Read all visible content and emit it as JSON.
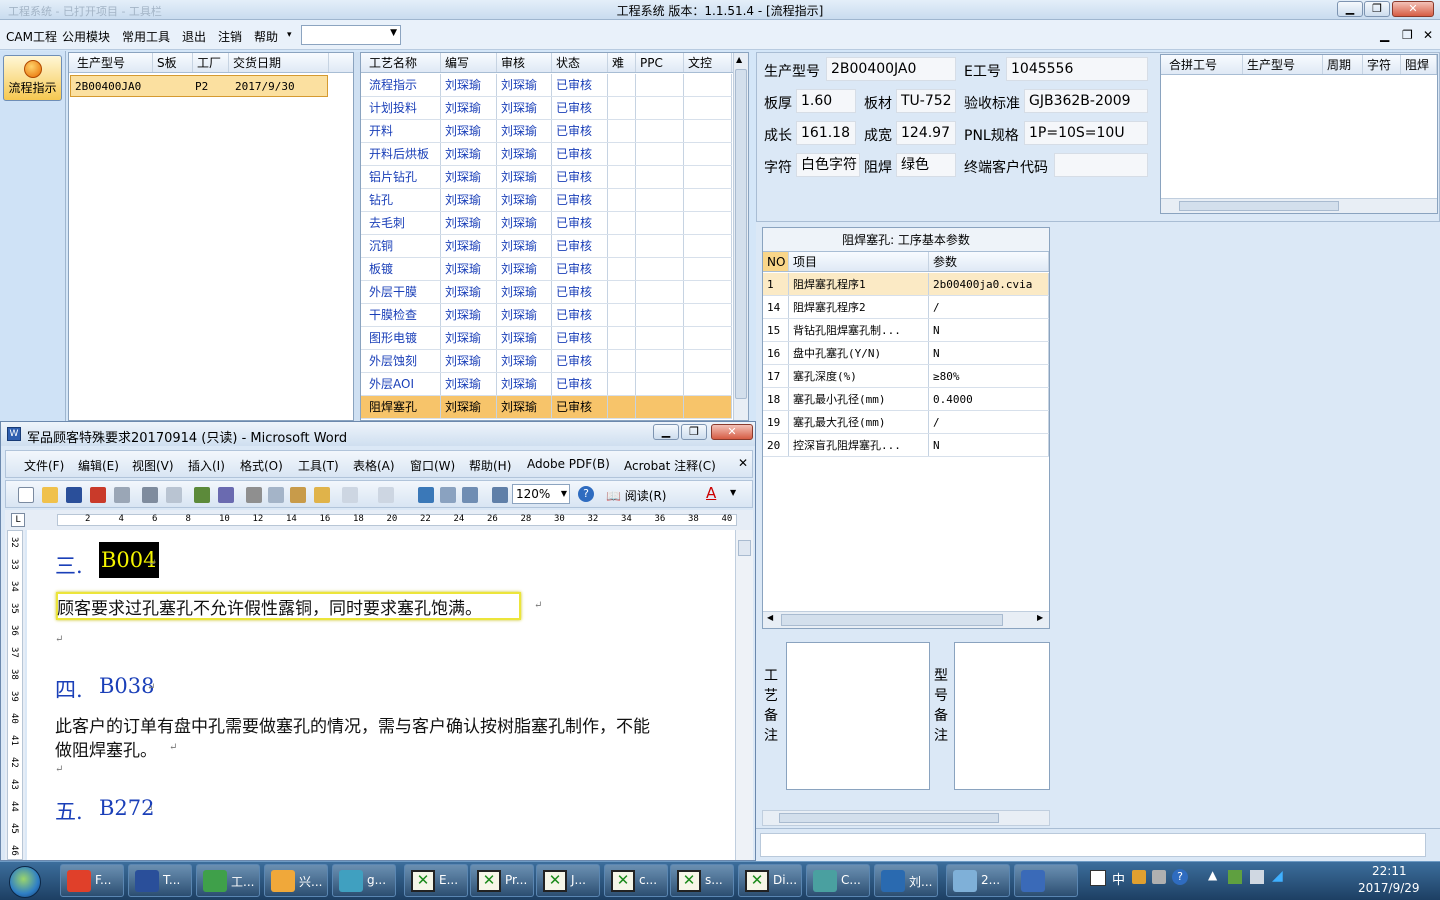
{
  "app": {
    "title": "工程系统   版本：1.1.51.4 - [流程指示]",
    "faint_title": "工程系统 - 已打开项目 - 工具栏",
    "window_buttons": {
      "minimize": "▁",
      "restore": "❐",
      "close": "✕"
    }
  },
  "menu": {
    "items": [
      "CAM工程",
      "公用模块",
      "常用工具",
      "退出",
      "注销",
      "帮助"
    ],
    "help_arrow": "▾",
    "mdi_buttons": [
      "▁",
      "❐",
      "✕"
    ]
  },
  "sidebar": {
    "flow_button": "流程指示"
  },
  "orders": {
    "headers": [
      "生产型号",
      "S板",
      "工厂",
      "交货日期"
    ],
    "rows": [
      {
        "model": "2B00400JA0",
        "s": "",
        "factory": "P2",
        "date": "2017/9/30"
      }
    ]
  },
  "process": {
    "headers": [
      "工艺名称",
      "编写",
      "审核",
      "状态",
      "难",
      "PPC",
      "文控"
    ],
    "rows": [
      {
        "name": "流程指示",
        "writer": "刘琛瑜",
        "reviewer": "刘琛瑜",
        "status": "已审核"
      },
      {
        "name": "计划投料",
        "writer": "刘琛瑜",
        "reviewer": "刘琛瑜",
        "status": "已审核"
      },
      {
        "name": "开料",
        "writer": "刘琛瑜",
        "reviewer": "刘琛瑜",
        "status": "已审核"
      },
      {
        "name": "开料后烘板",
        "writer": "刘琛瑜",
        "reviewer": "刘琛瑜",
        "status": "已审核"
      },
      {
        "name": "铝片钻孔",
        "writer": "刘琛瑜",
        "reviewer": "刘琛瑜",
        "status": "已审核"
      },
      {
        "name": "钻孔",
        "writer": "刘琛瑜",
        "reviewer": "刘琛瑜",
        "status": "已审核"
      },
      {
        "name": "去毛刺",
        "writer": "刘琛瑜",
        "reviewer": "刘琛瑜",
        "status": "已审核"
      },
      {
        "name": "沉铜",
        "writer": "刘琛瑜",
        "reviewer": "刘琛瑜",
        "status": "已审核"
      },
      {
        "name": "板镀",
        "writer": "刘琛瑜",
        "reviewer": "刘琛瑜",
        "status": "已审核"
      },
      {
        "name": "外层干膜",
        "writer": "刘琛瑜",
        "reviewer": "刘琛瑜",
        "status": "已审核"
      },
      {
        "name": "干膜检查",
        "writer": "刘琛瑜",
        "reviewer": "刘琛瑜",
        "status": "已审核"
      },
      {
        "name": "图形电镀",
        "writer": "刘琛瑜",
        "reviewer": "刘琛瑜",
        "status": "已审核"
      },
      {
        "name": "外层蚀刻",
        "writer": "刘琛瑜",
        "reviewer": "刘琛瑜",
        "status": "已审核"
      },
      {
        "name": "外层AOI",
        "writer": "刘琛瑜",
        "reviewer": "刘琛瑜",
        "status": "已审核"
      },
      {
        "name": "阻焊塞孔",
        "writer": "刘琛瑜",
        "reviewer": "刘琛瑜",
        "status": "已审核"
      }
    ]
  },
  "info": {
    "labels": {
      "model": "生产型号",
      "eno": "E工号",
      "thickness": "板厚",
      "material": "板材",
      "standard": "验收标准",
      "length": "成长",
      "width": "成宽",
      "pnl": "PNL规格",
      "char": "字符",
      "mask": "阻焊",
      "customer": "终端客户代码"
    },
    "values": {
      "model": "2B00400JA0",
      "eno": "1045556",
      "thickness": "1.60",
      "material": "TU-752",
      "standard": "GJB362B-2009",
      "length": "161.18",
      "width": "124.97",
      "pnl": "1P=10S=10U",
      "char": "白色字符",
      "mask": "绿色",
      "customer": ""
    }
  },
  "merge": {
    "headers": [
      "合拼工号",
      "生产型号",
      "周期",
      "字符",
      "阻焊"
    ]
  },
  "params": {
    "title": "阻焊塞孔: 工序基本参数",
    "headers": [
      "NO",
      "项目",
      "参数"
    ],
    "rows": [
      {
        "no": "1",
        "item": "阻焊塞孔程序1",
        "value": "2b00400ja0.cvia"
      },
      {
        "no": "14",
        "item": "阻焊塞孔程序2",
        "value": "/"
      },
      {
        "no": "15",
        "item": "背钻孔阻焊塞孔制...",
        "value": "N"
      },
      {
        "no": "16",
        "item": "盘中孔塞孔(Y/N)",
        "value": "N"
      },
      {
        "no": "17",
        "item": "塞孔深度(%)",
        "value": "≥80%"
      },
      {
        "no": "18",
        "item": "塞孔最小孔径(mm)",
        "value": "0.4000"
      },
      {
        "no": "19",
        "item": "塞孔最大孔径(mm)",
        "value": "/"
      },
      {
        "no": "20",
        "item": "控深盲孔阻焊塞孔...",
        "value": "N"
      }
    ]
  },
  "remarks": {
    "process": [
      "工",
      "艺",
      "备",
      "注"
    ],
    "model": [
      "型",
      "号",
      "备",
      "注"
    ]
  },
  "word": {
    "title": "军品顾客特殊要求20170914 (只读) - Microsoft Word",
    "menu": [
      "文件(F)",
      "编辑(E)",
      "视图(V)",
      "插入(I)",
      "格式(O)",
      "工具(T)",
      "表格(A)",
      "窗口(W)",
      "帮助(H)",
      "Adobe PDF(B)",
      "Acrobat 注释(C)"
    ],
    "zoom": "120%",
    "read_btn": "阅读(R)",
    "ruler_marks": [
      "2",
      "4",
      "6",
      "8",
      "10",
      "12",
      "14",
      "16",
      "18",
      "20",
      "22",
      "24",
      "26",
      "28",
      "30",
      "32",
      "34",
      "36",
      "38",
      "40"
    ],
    "v_ruler": [
      "32",
      "33",
      "34",
      "35",
      "36",
      "37",
      "38",
      "39",
      "40",
      "41",
      "42",
      "43",
      "44",
      "45",
      "46"
    ],
    "doc": {
      "h3_num": "三.",
      "h3_code": "B004",
      "p3": "顾客要求过孔塞孔不允许假性露铜，同时要求塞孔饱满。",
      "h4_num": "四.",
      "h4_code": "B038",
      "p4_line1": "此客户的订单有盘中孔需要做塞孔的情况，需与客户确认按树脂塞孔制作，不能",
      "p4_line2": "做阻焊塞孔。",
      "h5_num": "五.",
      "h5_code": "B272",
      "para_mark": "↵"
    }
  },
  "taskbar": {
    "buttons": [
      "F...",
      "T...",
      "工...",
      "兴...",
      "g...",
      "E...",
      "Pr...",
      "J...",
      "c...",
      "s...",
      "Di...",
      "C...",
      "刘...",
      "2...",
      ""
    ],
    "tray_text": "中",
    "time": "22:11",
    "date": "2017/9/29"
  },
  "colors": {
    "accent_orange": "#f7c46a",
    "link_blue": "#1a3fb8",
    "heading_blue": "#1a3fb8"
  }
}
